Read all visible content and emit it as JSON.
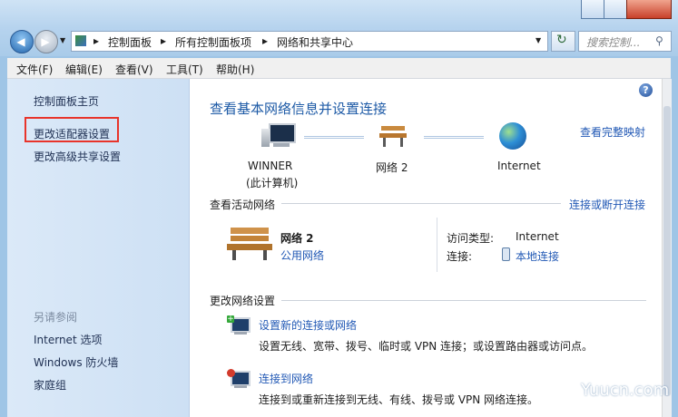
{
  "breadcrumb": {
    "part1": "控制面板",
    "part2": "所有控制面板项",
    "part3": "网络和共享中心"
  },
  "search": {
    "placeholder": "搜索控制..."
  },
  "menu": {
    "file": "文件(F)",
    "edit": "编辑(E)",
    "view": "查看(V)",
    "tools": "工具(T)",
    "help": "帮助(H)"
  },
  "sidebar": {
    "home": "控制面板主页",
    "adapter": "更改适配器设置",
    "sharing": "更改高级共享设置",
    "see_also": "另请参阅",
    "internet_options": "Internet 选项",
    "firewall": "Windows 防火墙",
    "homegroup": "家庭组"
  },
  "main": {
    "title": "查看基本网络信息并设置连接",
    "full_map": "查看完整映射",
    "map": {
      "computer_name": "WINNER",
      "computer_sub": "(此计算机)",
      "network": "网络  2",
      "internet": "Internet"
    },
    "active_heading": "查看活动网络",
    "connect_disconnect": "连接或断开连接",
    "active": {
      "name": "网络  2",
      "type": "公用网络",
      "access_label": "访问类型:",
      "access_value": "Internet",
      "conn_label": "连接:",
      "conn_value": "本地连接"
    },
    "change_heading": "更改网络设置",
    "tasks": [
      {
        "title": "设置新的连接或网络",
        "desc": "设置无线、宽带、拨号、临时或 VPN 连接；或设置路由器或访问点。"
      },
      {
        "title": "连接到网络",
        "desc": "连接到或重新连接到无线、有线、拨号或 VPN 网络连接。"
      }
    ]
  },
  "watermark": "Yuucn.com"
}
